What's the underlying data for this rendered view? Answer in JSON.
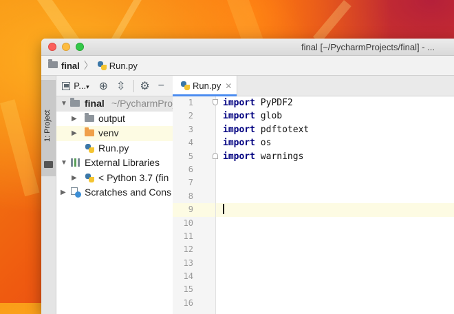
{
  "window": {
    "title": "final [~/PycharmProjects/final] - ..."
  },
  "navbar": {
    "crumbs": [
      "final",
      "Run.py"
    ]
  },
  "tool_strip": {
    "project_tab": "1: Project"
  },
  "project_panel": {
    "title": "P...",
    "tree": [
      {
        "label": "final",
        "extra": "~/PycharmProje"
      },
      {
        "label": "output"
      },
      {
        "label": "venv"
      },
      {
        "label": "Run.py"
      },
      {
        "label": "External Libraries"
      },
      {
        "label": "< Python 3.7 (fin"
      },
      {
        "label": "Scratches and Cons"
      }
    ]
  },
  "editor": {
    "tab": "Run.py",
    "line_numbers": [
      "1",
      "2",
      "3",
      "4",
      "5",
      "6",
      "7",
      "8",
      "9",
      "10",
      "11",
      "12",
      "13",
      "14",
      "15",
      "16"
    ],
    "lines": [
      {
        "keyword": "import",
        "text": " PyPDF2"
      },
      {
        "keyword": "import",
        "text": " glob"
      },
      {
        "keyword": "import",
        "text": " pdftotext"
      },
      {
        "keyword": "import",
        "text": " os"
      },
      {
        "keyword": "import",
        "text": " warnings"
      }
    ],
    "current_line": "9"
  }
}
